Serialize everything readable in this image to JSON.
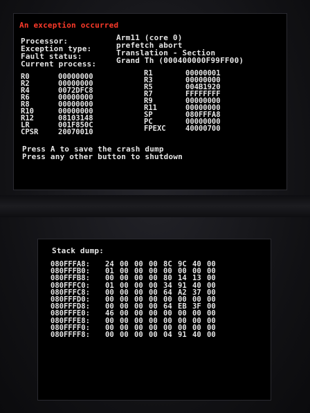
{
  "top_screen": {
    "title": "An exception occurred",
    "info": [
      {
        "label": "Processor:",
        "value": "Arm11 (core 0)"
      },
      {
        "label": "Exception type:",
        "value": "prefetch abort"
      },
      {
        "label": "Fault status:",
        "value": "Translation - Section"
      },
      {
        "label": "Current process:",
        "value": "Grand Th (000400000F99FF00)"
      }
    ],
    "registers_left": [
      {
        "name": "R0",
        "value": "00000000"
      },
      {
        "name": "R2",
        "value": "00000000"
      },
      {
        "name": "R4",
        "value": "0072DFC8"
      },
      {
        "name": "R6",
        "value": "00000000"
      },
      {
        "name": "R8",
        "value": "00000000"
      },
      {
        "name": "R10",
        "value": "00000000"
      },
      {
        "name": "R12",
        "value": "08103148"
      },
      {
        "name": "LR",
        "value": "001F850C"
      },
      {
        "name": "CPSR",
        "value": "20070010"
      }
    ],
    "registers_right": [
      {
        "name": "R1",
        "value": "00000001"
      },
      {
        "name": "R3",
        "value": "00000000"
      },
      {
        "name": "R5",
        "value": "004B1920"
      },
      {
        "name": "R7",
        "value": "FFFFFFFF"
      },
      {
        "name": "R9",
        "value": "00000000"
      },
      {
        "name": "R11",
        "value": "00000000"
      },
      {
        "name": "SP",
        "value": "080FFFA8"
      },
      {
        "name": "PC",
        "value": "00000000"
      },
      {
        "name": "FPEXC",
        "value": "40000700"
      }
    ],
    "prompt_line1": "Press A to save the crash dump",
    "prompt_line2": "Press any other button to shutdown"
  },
  "bottom_screen": {
    "title": "Stack dump:",
    "rows": [
      {
        "address": "080FFFA8:",
        "bytes": [
          "24",
          "00",
          "00",
          "00",
          "8C",
          "9C",
          "40",
          "00"
        ]
      },
      {
        "address": "080FFFB0:",
        "bytes": [
          "01",
          "00",
          "00",
          "00",
          "00",
          "00",
          "00",
          "00"
        ]
      },
      {
        "address": "080FFFB8:",
        "bytes": [
          "00",
          "00",
          "00",
          "00",
          "80",
          "14",
          "13",
          "00"
        ]
      },
      {
        "address": "080FFFC0:",
        "bytes": [
          "01",
          "00",
          "00",
          "00",
          "34",
          "91",
          "40",
          "00"
        ]
      },
      {
        "address": "080FFFC8:",
        "bytes": [
          "00",
          "00",
          "00",
          "00",
          "64",
          "A2",
          "37",
          "00"
        ]
      },
      {
        "address": "080FFFD0:",
        "bytes": [
          "00",
          "00",
          "00",
          "00",
          "00",
          "00",
          "00",
          "00"
        ]
      },
      {
        "address": "080FFFD8:",
        "bytes": [
          "00",
          "00",
          "00",
          "00",
          "64",
          "EB",
          "3F",
          "00"
        ]
      },
      {
        "address": "080FFFE0:",
        "bytes": [
          "46",
          "00",
          "00",
          "00",
          "00",
          "00",
          "00",
          "00"
        ]
      },
      {
        "address": "080FFFE8:",
        "bytes": [
          "00",
          "00",
          "00",
          "00",
          "00",
          "00",
          "00",
          "00"
        ]
      },
      {
        "address": "080FFFF0:",
        "bytes": [
          "00",
          "00",
          "00",
          "00",
          "00",
          "00",
          "00",
          "00"
        ]
      },
      {
        "address": "080FFFF8:",
        "bytes": [
          "00",
          "00",
          "00",
          "00",
          "04",
          "91",
          "40",
          "00"
        ]
      }
    ]
  }
}
